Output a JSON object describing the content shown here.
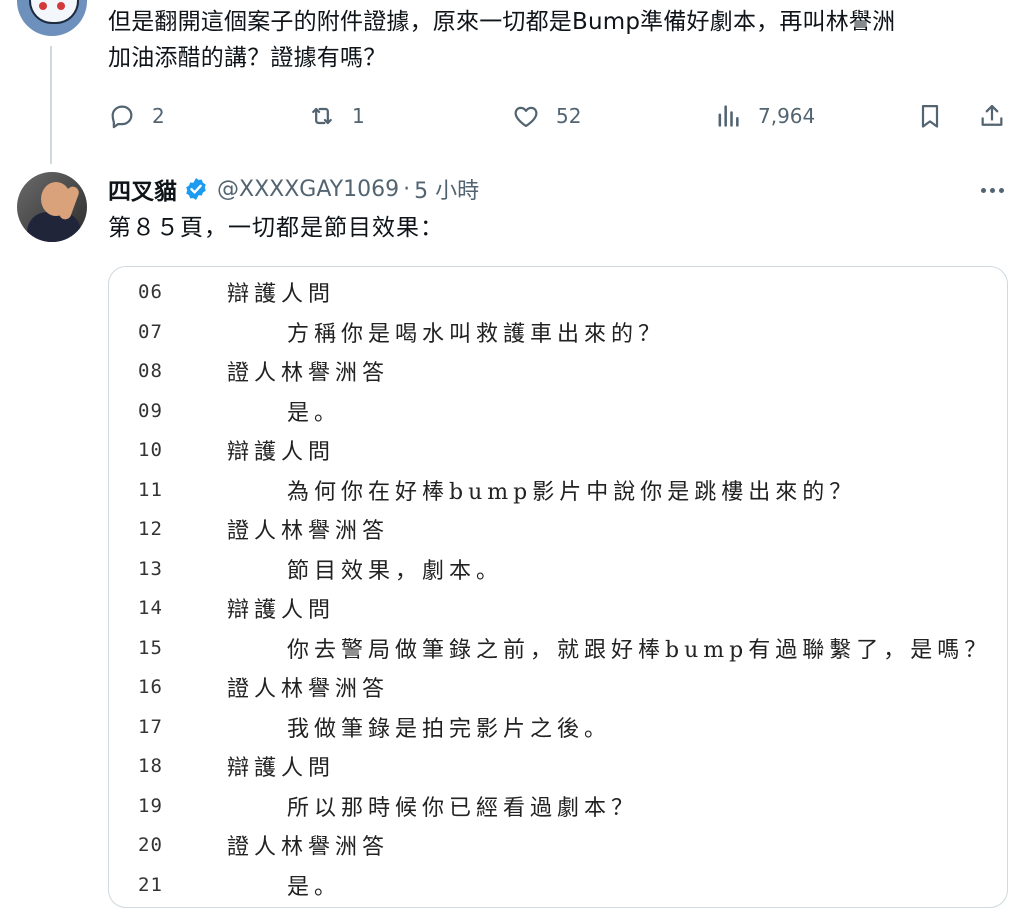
{
  "prev_tweet": {
    "text_line1": "但是翻開這個案子的附件證據，原來一切都是Bump準備好劇本，再叫林譽洲",
    "text_line2": "加油添醋的講？證據有嗎？",
    "actions": {
      "replies": "2",
      "retweets": "1",
      "likes": "52",
      "views": "7,964"
    }
  },
  "tweet": {
    "display_name": "四叉貓",
    "handle": "@XXXXGAY1069",
    "separator": "·",
    "time": "5 小時",
    "text": "第８５頁，一切都是節目效果：",
    "media": {
      "lines": [
        {
          "no": "06",
          "type": "speaker",
          "text": "辯護人問"
        },
        {
          "no": "07",
          "type": "answer",
          "text": "方稱你是喝水叫救護車出來的？"
        },
        {
          "no": "08",
          "type": "speaker",
          "text": "證人林譽洲答"
        },
        {
          "no": "09",
          "type": "answer",
          "text": "是。"
        },
        {
          "no": "10",
          "type": "speaker",
          "text": "辯護人問"
        },
        {
          "no": "11",
          "type": "answer",
          "text": "為何你在好棒bump影片中說你是跳樓出來的？"
        },
        {
          "no": "12",
          "type": "speaker",
          "text": "證人林譽洲答"
        },
        {
          "no": "13",
          "type": "answer",
          "text": "節目效果，劇本。"
        },
        {
          "no": "14",
          "type": "speaker",
          "text": "辯護人問"
        },
        {
          "no": "15",
          "type": "answer",
          "text": "你去警局做筆錄之前，就跟好棒bump有過聯繫了，是嗎？"
        },
        {
          "no": "16",
          "type": "speaker",
          "text": "證人林譽洲答"
        },
        {
          "no": "17",
          "type": "answer",
          "text": "我做筆錄是拍完影片之後。"
        },
        {
          "no": "18",
          "type": "speaker",
          "text": "辯護人問"
        },
        {
          "no": "19",
          "type": "answer",
          "text": "所以那時候你已經看過劇本？"
        },
        {
          "no": "20",
          "type": "speaker",
          "text": "證人林譽洲答"
        },
        {
          "no": "21",
          "type": "answer",
          "text": "是。"
        }
      ]
    }
  },
  "icons": {
    "reply": "reply-icon",
    "retweet": "retweet-icon",
    "like": "heart-icon",
    "views": "views-icon",
    "bookmark": "bookmark-icon",
    "share": "share-icon",
    "verified": "verified-badge-icon",
    "more": "more-icon"
  },
  "colors": {
    "text": "#0f1419",
    "secondary": "#536471",
    "verified": "#1d9bf0",
    "border": "#cfd9de"
  }
}
